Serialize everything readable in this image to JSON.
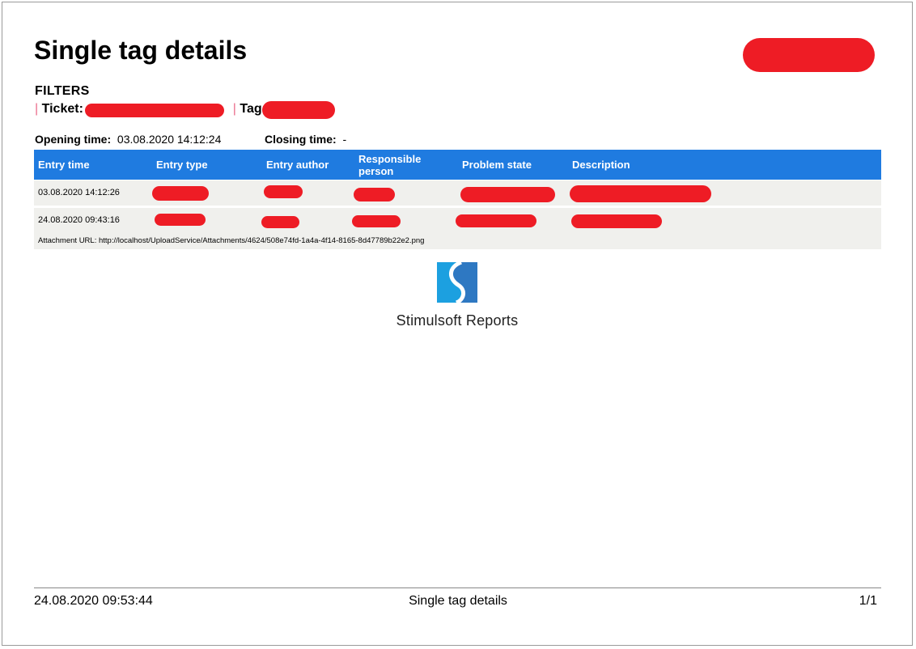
{
  "report": {
    "title": "Single tag details",
    "filters_label": "FILTERS",
    "separator": "|",
    "ticket_label": "Ticket:",
    "tag_label": "Tag:",
    "opening_label": "Opening time:",
    "opening_value": "03.08.2020 14:12:24",
    "closing_label": "Closing time:",
    "closing_value": "-"
  },
  "table": {
    "header_color": "#1f7be0",
    "columns": [
      "Entry time",
      "Entry type",
      "Entry author",
      "Responsible person",
      "Problem state",
      "Description"
    ],
    "rows": [
      {
        "entry_time": "03.08.2020 14:12:26"
      },
      {
        "entry_time": "24.08.2020 09:43:16",
        "attachment": "Attachment URL: http://localhost/UploadService/Attachments/4624/508e74fd-1a4a-4f14-8165-8d47789b22e2.png"
      }
    ]
  },
  "logo": {
    "icon": "stimulsoft-logo-icon",
    "text": "Stimulsoft Reports"
  },
  "footer": {
    "timestamp": "24.08.2020 09:53:44",
    "title": "Single tag details",
    "page": "1/1"
  },
  "redaction_color": "#ee1c25"
}
